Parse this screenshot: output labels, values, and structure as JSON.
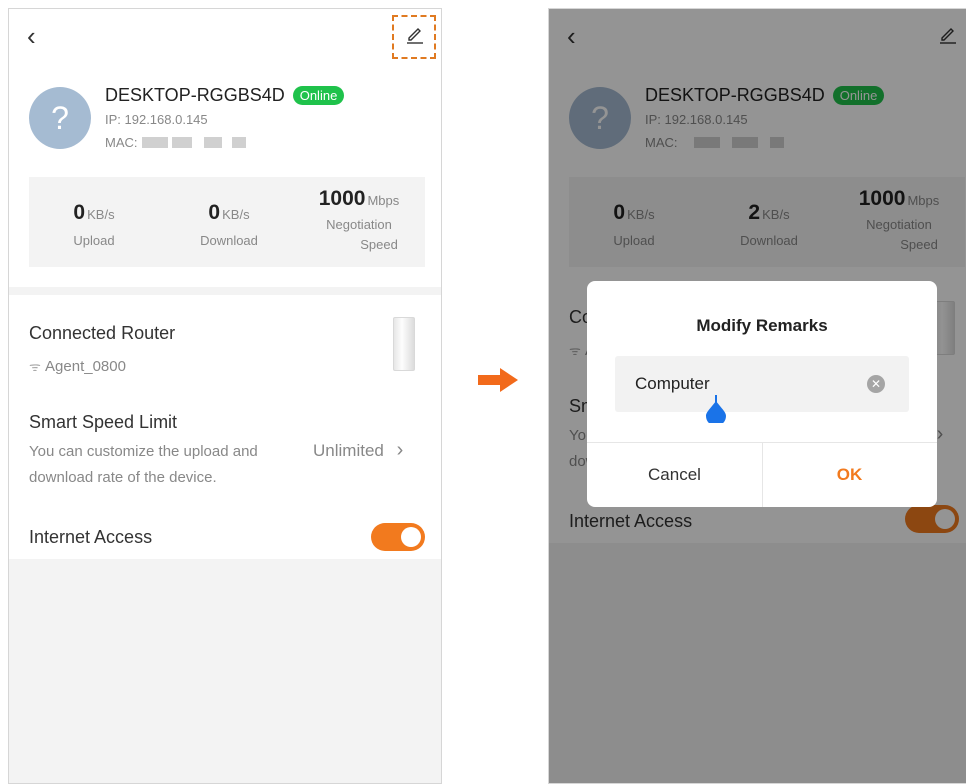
{
  "device": {
    "name": "DESKTOP-RGGBS4D",
    "status": "Online",
    "ip": "IP: 192.168.0.145",
    "mac_label": "MAC:",
    "avatar_glyph": "?"
  },
  "stats_left": {
    "upload": {
      "value": "0",
      "unit": "KB/s",
      "label": "Upload"
    },
    "download": {
      "value": "0",
      "unit": "KB/s",
      "label": "Download"
    },
    "negotiation": {
      "value": "1000",
      "unit": "Mbps",
      "label_line1": "Negotiation",
      "label_line2": "Speed"
    }
  },
  "stats_right": {
    "upload": {
      "value": "0",
      "unit": "KB/s",
      "label": "Upload"
    },
    "download": {
      "value": "2",
      "unit": "KB/s",
      "label": "Download"
    },
    "negotiation": {
      "value": "1000",
      "unit": "Mbps",
      "label_line1": "Negotiation",
      "label_line2": "Speed"
    }
  },
  "connected_router": {
    "title": "Connected Router",
    "ssid": "Agent_0800"
  },
  "speed_limit": {
    "title": "Smart Speed Limit",
    "desc_line1": "You can customize the upload and",
    "desc_line2": "download rate of the device.",
    "value": "Unlimited"
  },
  "internet_access": {
    "title": "Internet Access",
    "enabled": true
  },
  "dialog": {
    "title": "Modify Remarks",
    "input_value": "Computer",
    "cancel_label": "Cancel",
    "ok_label": "OK"
  },
  "colors": {
    "accent": "#f27a1e",
    "online": "#1fc24b",
    "avatar": "#a5bbd2"
  },
  "icons": [
    "back-icon",
    "edit-icon",
    "wifi-icon",
    "chevron-right-icon",
    "clear-icon",
    "arrow-right-icon"
  ]
}
